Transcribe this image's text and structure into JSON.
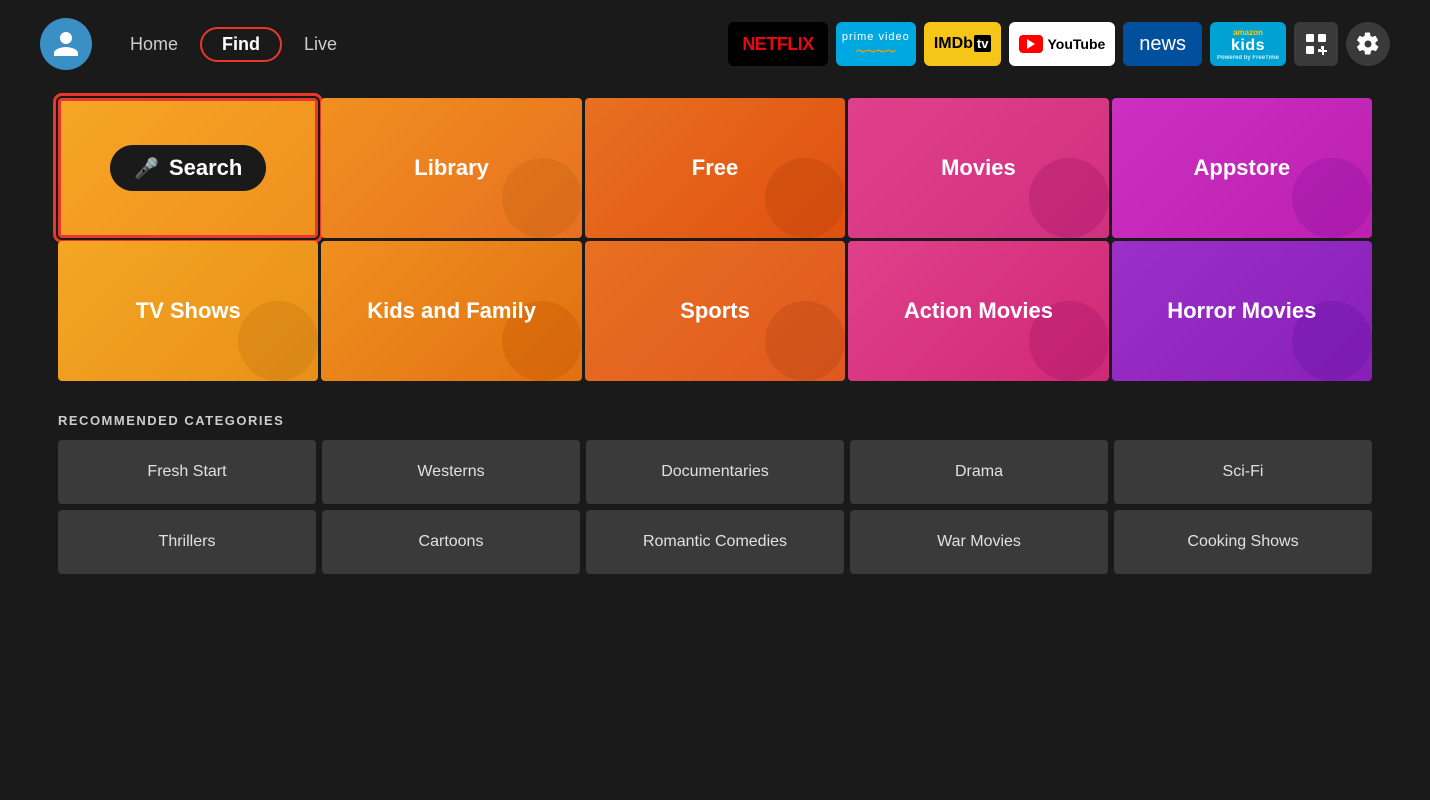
{
  "header": {
    "nav": {
      "home_label": "Home",
      "find_label": "Find",
      "live_label": "Live"
    },
    "streaming": {
      "netflix_label": "NETFLIX",
      "prime_label": "prime video",
      "prime_sublabel": "~~~~",
      "imdb_label": "IMDb",
      "imdb_tv_label": "tv",
      "youtube_label": "YouTube",
      "news_label": "news",
      "kids_label": "kids",
      "kids_sublabel": "amazon",
      "kids_sub2": "Powered by FreeTime"
    }
  },
  "main_grid": {
    "tiles": [
      {
        "id": "search",
        "label": "Search"
      },
      {
        "id": "library",
        "label": "Library"
      },
      {
        "id": "free",
        "label": "Free"
      },
      {
        "id": "movies",
        "label": "Movies"
      },
      {
        "id": "appstore",
        "label": "Appstore"
      },
      {
        "id": "tvshows",
        "label": "TV Shows"
      },
      {
        "id": "kids",
        "label": "Kids and Family"
      },
      {
        "id": "sports",
        "label": "Sports"
      },
      {
        "id": "action",
        "label": "Action Movies"
      },
      {
        "id": "horror",
        "label": "Horror Movies"
      }
    ]
  },
  "recommended": {
    "title": "RECOMMENDED CATEGORIES",
    "row1": [
      {
        "id": "fresh-start",
        "label": "Fresh Start"
      },
      {
        "id": "westerns",
        "label": "Westerns"
      },
      {
        "id": "documentaries",
        "label": "Documentaries"
      },
      {
        "id": "drama",
        "label": "Drama"
      },
      {
        "id": "scifi",
        "label": "Sci-Fi"
      }
    ],
    "row2": [
      {
        "id": "thrillers",
        "label": "Thrillers"
      },
      {
        "id": "cartoons",
        "label": "Cartoons"
      },
      {
        "id": "romcom",
        "label": "Romantic Comedies"
      },
      {
        "id": "war",
        "label": "War Movies"
      },
      {
        "id": "cooking",
        "label": "Cooking Shows"
      }
    ]
  }
}
